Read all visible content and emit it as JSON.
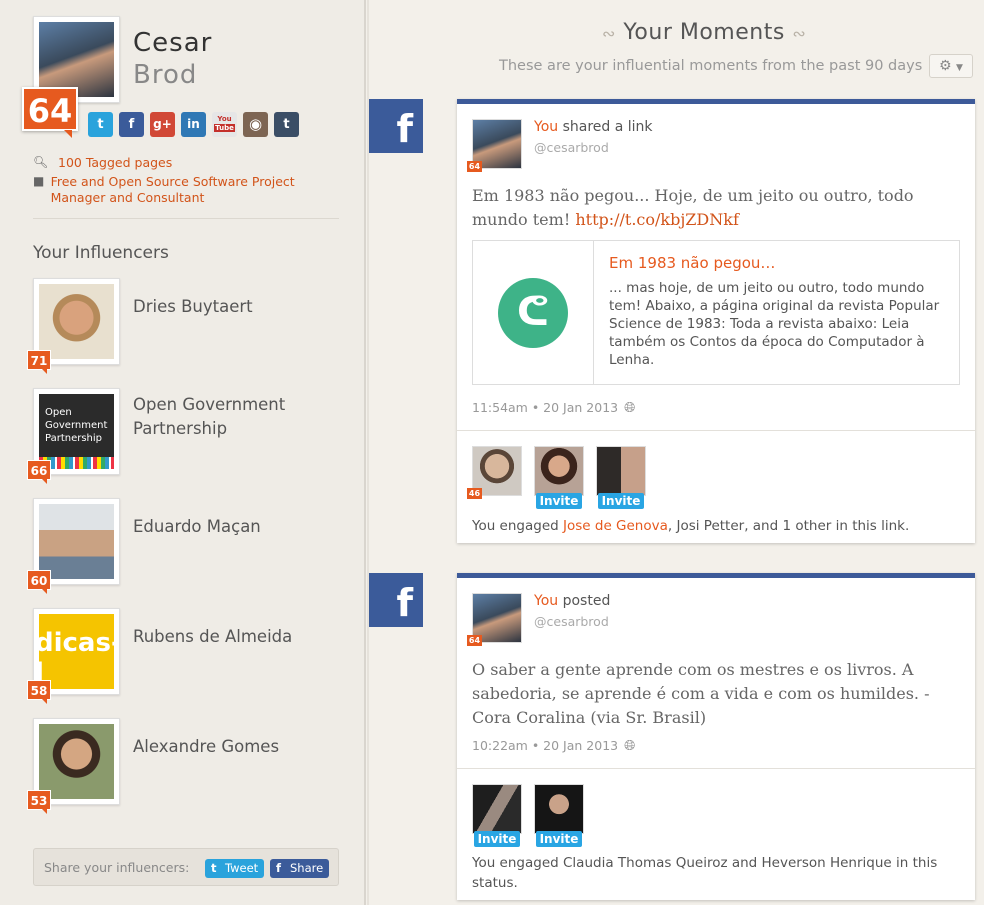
{
  "profile": {
    "first_name": "Cesar",
    "last_name": "Brod",
    "score": "64",
    "tagged_pages": "100 Tagged pages",
    "job": "Free and Open Source Software Project Manager and Consultant",
    "social_networks": [
      {
        "name": "twitter",
        "glyph": "t",
        "color": "#2aa3dc"
      },
      {
        "name": "facebook",
        "glyph": "f",
        "color": "#3b5b9a"
      },
      {
        "name": "google-plus",
        "glyph": "g+",
        "color": "#d14836"
      },
      {
        "name": "linkedin",
        "glyph": "in",
        "color": "#2f78b5"
      },
      {
        "name": "youtube",
        "glyph": "You\nTube",
        "color": "#e6e6e6"
      },
      {
        "name": "instagram",
        "glyph": "◉",
        "color": "#7d6553"
      },
      {
        "name": "tumblr",
        "glyph": "t",
        "color": "#3b4e66"
      }
    ]
  },
  "influencers_title": "Your Influencers",
  "influencers": [
    {
      "name": "Dries Buytaert",
      "score": "71"
    },
    {
      "name": "Open Government Partnership",
      "score": "66",
      "logo_text": "Open Government Partnership"
    },
    {
      "name": "Eduardo Maçan",
      "score": "60"
    },
    {
      "name": "Rubens de Almeida",
      "score": "58",
      "logo_text": "dicas-l"
    },
    {
      "name": "Alexandre Gomes",
      "score": "53"
    }
  ],
  "share": {
    "label": "Share your influencers:",
    "tweet": "Tweet",
    "share": "Share"
  },
  "main": {
    "title": "Your Moments",
    "subtitle": "These are your influential moments from the past 90 days"
  },
  "moments": [
    {
      "you": "You",
      "action": " shared a link",
      "handle": "@cesarbrod",
      "score": "64",
      "text": "Em 1983 não pegou... Hoje, de um jeito ou outro, todo mundo tem! ",
      "link": "http://t.co/kbjZDNkf",
      "link_title": "Em 1983 não pegou…",
      "link_desc": "... mas hoje, de um jeito ou outro, todo mundo tem! Abaixo, a página original da revista Popular Science de 1983: Toda a revista abaixo: Leia também os Contos da época do Computador à Lenha.",
      "time": "11:54am • 20 Jan 2013",
      "engaged_prefix": "You engaged ",
      "engaged_highlight": "Jose de Genova",
      "engaged_rest": ", Josi Petter, and 1 other in this link.",
      "engager_score": "46",
      "invite": "Invite"
    },
    {
      "you": "You",
      "action": " posted",
      "handle": "@cesarbrod",
      "score": "64",
      "text": "O saber a gente aprende com os mestres e os livros. A sabedoria, se aprende é com a vida e com os humildes. - Cora Coralina (via Sr. Brasil)",
      "time": "10:22am • 20 Jan 2013",
      "engaged_text": "You engaged Claudia Thomas Queiroz and Heverson Henrique in this status.",
      "invite": "Invite"
    }
  ],
  "colors": {
    "accent": "#e65a1f",
    "facebook": "#3b5b9a",
    "invite": "#29a5e3"
  }
}
